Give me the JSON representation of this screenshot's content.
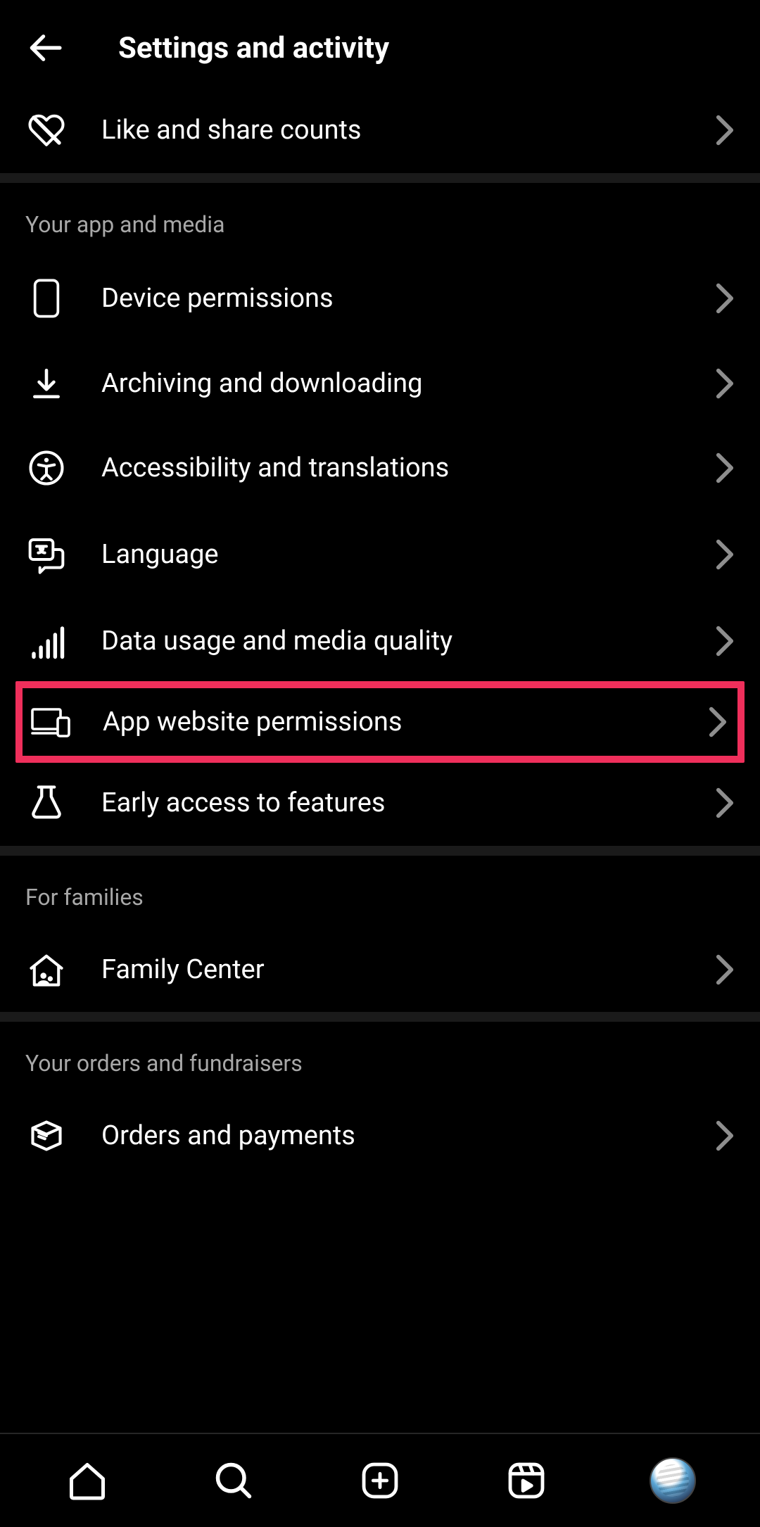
{
  "header": {
    "title": "Settings and activity"
  },
  "top_rows": [
    {
      "id": "like-share",
      "label": "Like and share counts"
    }
  ],
  "sections": [
    {
      "title": "Your app and media",
      "items": [
        {
          "id": "device-permissions",
          "label": "Device permissions"
        },
        {
          "id": "archiving-downloading",
          "label": "Archiving and downloading"
        },
        {
          "id": "accessibility-translations",
          "label": "Accessibility and translations"
        },
        {
          "id": "language",
          "label": "Language"
        },
        {
          "id": "data-usage",
          "label": "Data usage and media quality"
        },
        {
          "id": "app-website-permissions",
          "label": "App website permissions",
          "highlighted": true
        },
        {
          "id": "early-access",
          "label": "Early access to features"
        }
      ]
    },
    {
      "title": "For families",
      "items": [
        {
          "id": "family-center",
          "label": "Family Center"
        }
      ]
    },
    {
      "title": "Your orders and fundraisers",
      "items": [
        {
          "id": "orders-payments",
          "label": "Orders and payments"
        }
      ]
    }
  ]
}
